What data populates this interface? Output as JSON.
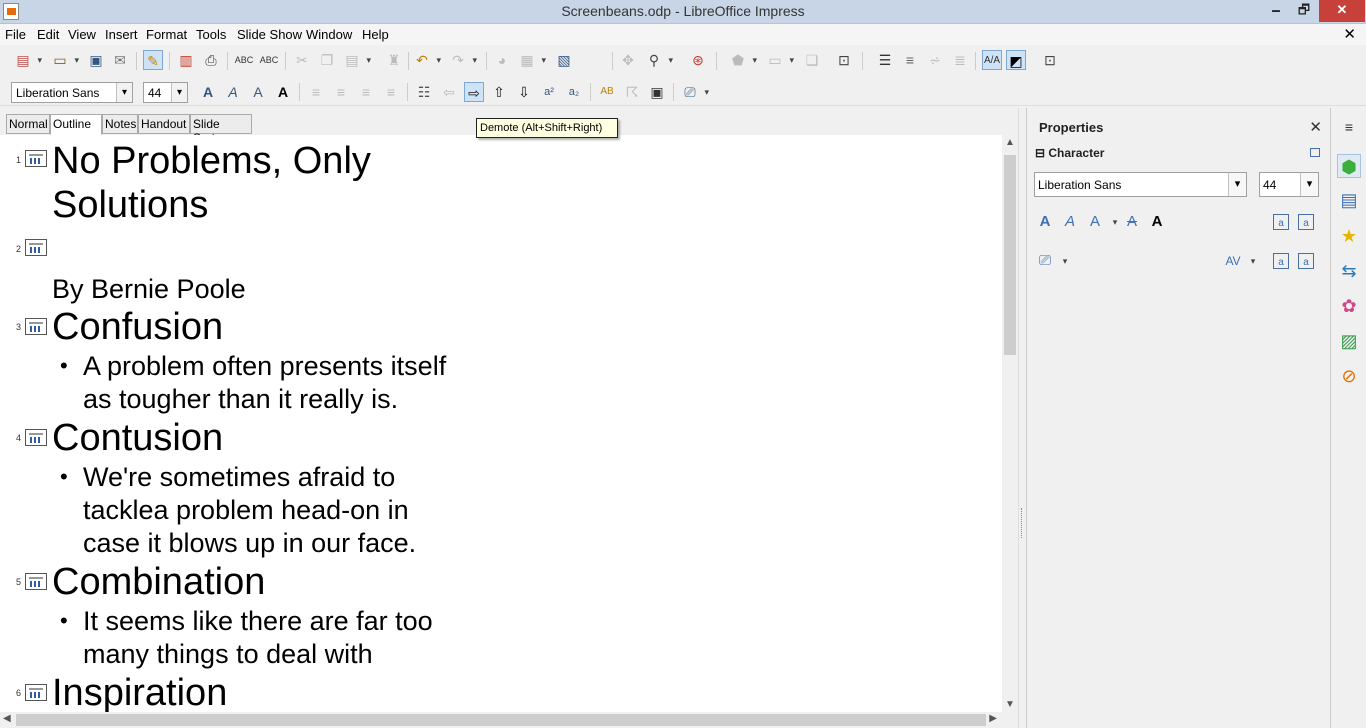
{
  "window": {
    "title": "Screenbeans.odp - LibreOffice Impress",
    "min": "🗕",
    "max": "🗗",
    "close": "✕"
  },
  "menu": {
    "items": [
      "File",
      "Edit",
      "View",
      "Insert",
      "Format",
      "Tools",
      "Slide Show",
      "Window",
      "Help"
    ],
    "doc_close": "✕"
  },
  "toolbar": {
    "font_name": "Liberation Sans",
    "font_size": "44"
  },
  "view_tabs": [
    "Normal",
    "Outline",
    "Notes",
    "Handout",
    "Slide Sorter"
  ],
  "active_view": "Outline",
  "tooltip": "Demote (Alt+Shift+Right)",
  "outline": [
    {
      "num": "1",
      "title": [
        "No Problems, Only",
        "Solutions"
      ],
      "bullets": []
    },
    {
      "num": "2",
      "title": [
        ""
      ],
      "subtitle": "By Bernie Poole",
      "bullets": []
    },
    {
      "num": "3",
      "title": [
        "Confusion"
      ],
      "bullets": [
        [
          "A problem often presents itself",
          "as tougher than it really is."
        ]
      ]
    },
    {
      "num": "4",
      "title": [
        "Contusion"
      ],
      "bullets": [
        [
          "We're sometimes afraid to",
          "tacklea problem head-on in",
          "case it blows up in our face."
        ]
      ]
    },
    {
      "num": "5",
      "title": [
        "Combination"
      ],
      "bullets": [
        [
          "It seems like there are far too",
          "many things to deal with"
        ]
      ]
    },
    {
      "num": "6",
      "title": [
        "Inspiration"
      ],
      "bullets": []
    }
  ],
  "sidebar": {
    "title": "Properties",
    "close": "✕",
    "section": "Character",
    "font_name": "Liberation Sans",
    "font_size": "44"
  },
  "colors": {
    "accent": "#3f6fb4",
    "titlebar": "#c7d5e6",
    "close": "#c7403a"
  }
}
